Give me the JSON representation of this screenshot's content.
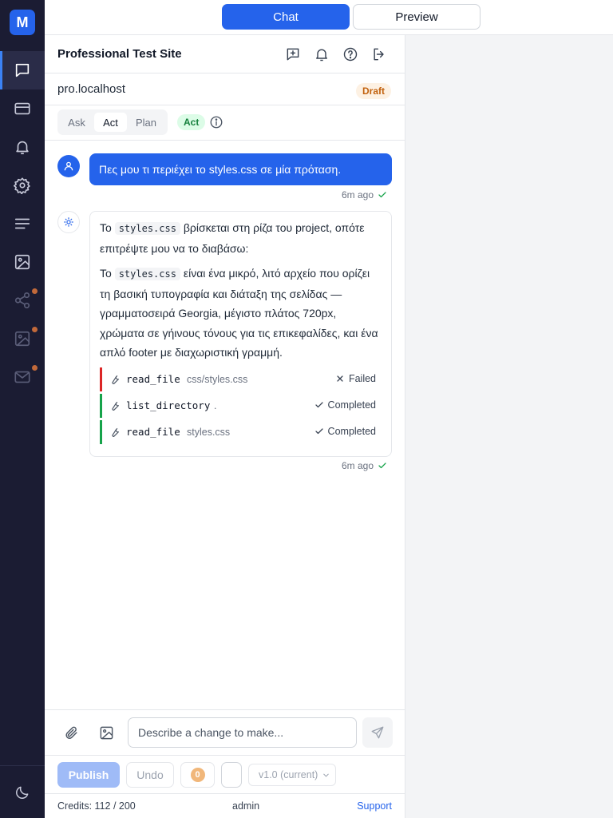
{
  "app": {
    "logo_letter": "M"
  },
  "sidebar": {
    "items": [
      {
        "name": "chat",
        "icon": "chat-icon",
        "active": true
      },
      {
        "name": "card",
        "icon": "card-icon"
      },
      {
        "name": "notifications",
        "icon": "bell-icon"
      },
      {
        "name": "settings",
        "icon": "gear-icon"
      },
      {
        "name": "content",
        "icon": "lines-icon"
      },
      {
        "name": "media",
        "icon": "image-icon"
      },
      {
        "name": "share",
        "icon": "share-icon",
        "disabled": true,
        "dot": true
      },
      {
        "name": "gallery",
        "icon": "image-icon",
        "disabled": true,
        "dot": true
      },
      {
        "name": "mail",
        "icon": "mail-icon",
        "disabled": true,
        "dot": true
      }
    ],
    "theme_icon": "moon-icon"
  },
  "tabs": {
    "chat": "Chat",
    "preview": "Preview"
  },
  "header": {
    "site_name": "Professional Test Site",
    "domain": "pro.localhost",
    "status_badge": "Draft"
  },
  "modes": {
    "options": [
      "Ask",
      "Act",
      "Plan"
    ],
    "selected": "Act",
    "current_badge": "Act"
  },
  "messages": {
    "user": {
      "text": "Πες μου τι περιέχει το styles.css σε μία πρόταση.",
      "time": "6m ago"
    },
    "assistant": {
      "p1_pre": "Το",
      "p1_code": "styles.css",
      "p1_post": "βρίσκεται στη ρίζα του project, οπότε επιτρέψτε μου να το διαβάσω:",
      "p2_pre": "Το",
      "p2_code": "styles.css",
      "p2_post": "είναι ένα μικρό, λιτό αρχείο που ορίζει τη βασική τυπογραφία και διάταξη της σελίδας — γραμματοσειρά Georgia, μέγιστο πλάτος 720px, χρώματα σε γήινους τόνους για τις επικεφαλίδες, και ένα απλό footer με διαχωριστική γραμμή.",
      "tools": [
        {
          "name": "read_file",
          "arg": "css/styles.css",
          "status": "Failed"
        },
        {
          "name": "list_directory",
          "arg": ".",
          "status": "Completed"
        },
        {
          "name": "read_file",
          "arg": "styles.css",
          "status": "Completed"
        }
      ],
      "time": "6m ago"
    }
  },
  "composer": {
    "placeholder": "Describe a change to make..."
  },
  "actions": {
    "publish": "Publish",
    "undo": "Undo",
    "count": "0",
    "version": "v1.0 (current)"
  },
  "footer": {
    "credits": "Credits: 112 / 200",
    "user": "admin",
    "support": "Support"
  },
  "colors": {
    "primary": "#2563eb",
    "sidebar_bg": "#1b1c33",
    "draft_badge": "#c2620f",
    "act_badge": "#15803d",
    "failed": "#dc2626",
    "completed": "#16a34a"
  }
}
